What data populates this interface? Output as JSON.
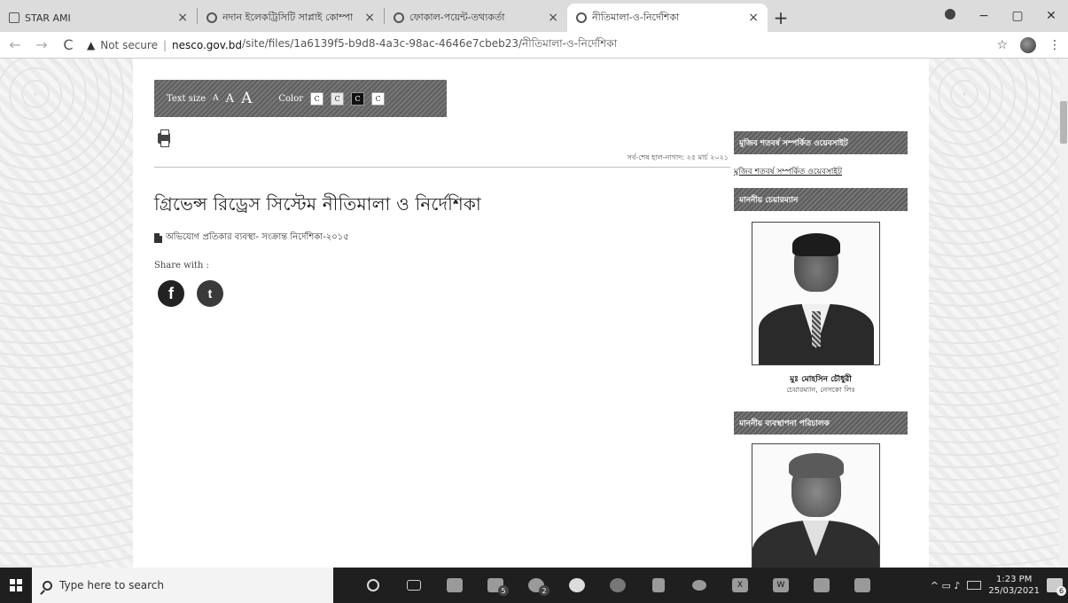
{
  "browser": {
    "tabs": [
      {
        "title": "STAR AMI",
        "active": false
      },
      {
        "title": "নদান ইলেকট্রিসিটি সাপ্লাই কোম্পা",
        "active": false
      },
      {
        "title": "ফোকাল-পয়েন্ট-তথ্যকর্তা",
        "active": false
      },
      {
        "title": "নীতিমালা-ও-নির্দেশিকা",
        "active": true
      }
    ],
    "new_tab": "+",
    "win_min": "−",
    "win_max": "▢",
    "win_close": "✕",
    "back": "←",
    "forward": "→",
    "reload": "C",
    "security_label": "Not secure",
    "url_sep": "|",
    "url_host": "nesco.gov.bd",
    "url_path": "/site/files/1a6139f5-b9d8-4a3c-98ac-4646e7cbeb23/নীতিমালা-ও-নির্দেশিকা",
    "star": "☆",
    "menu": "⋮"
  },
  "toolbar": {
    "text_size_label": "Text size",
    "a_small": "A",
    "a_medium": "A",
    "a_large": "A",
    "color_label": "Color",
    "color_options": [
      "C",
      "C",
      "C",
      "C"
    ]
  },
  "content": {
    "updated": "সর্ব-শেষ হাল-নাগাদ: ২৫ মার্চ ২০২১",
    "title": "গ্রিভেন্স রিড্রেস সিস্টেম নীতিমালা ও নির্দেশিকা",
    "document_link": "অভিযোগ প্রতিকার ব্যবস্থা- সংক্রান্ত নির্দেশিকা-২০১৫",
    "share_label": "Share with :",
    "facebook_glyph": "f",
    "twitter_glyph": "t"
  },
  "sidebar": {
    "block1_heading": "মুজিব শতবর্ষ সম্পর্কিত ওয়েবসাইট",
    "block1_link": "মুজিব শতবর্ষ সম্পর্কিত ওয়েবসাইট",
    "block2_heading": "মাননীয় চেয়ারম্যান",
    "chairman_name": "মুঃ মোহসিন চৌধুরী",
    "chairman_role": "চেয়ারম্যান, নেসকো লিঃ",
    "block3_heading": "মাননীয় ব্যবস্থাপনা পরিচালক"
  },
  "taskbar": {
    "search_placeholder": "Type here to search",
    "icons": [
      "cortana",
      "task-view",
      "file-explorer",
      "mail",
      "chrome-profile",
      "security",
      "chrome",
      "network-app",
      "app",
      "excel",
      "word",
      "camera",
      "photos"
    ],
    "badge_mail": "5",
    "badge_profile": "2",
    "excel_glyph": "X",
    "word_glyph": "W",
    "tray_glyphs": "^  ▭  ♪",
    "time": "1:23 PM",
    "date": "25/03/2021",
    "notif_count": "6"
  }
}
